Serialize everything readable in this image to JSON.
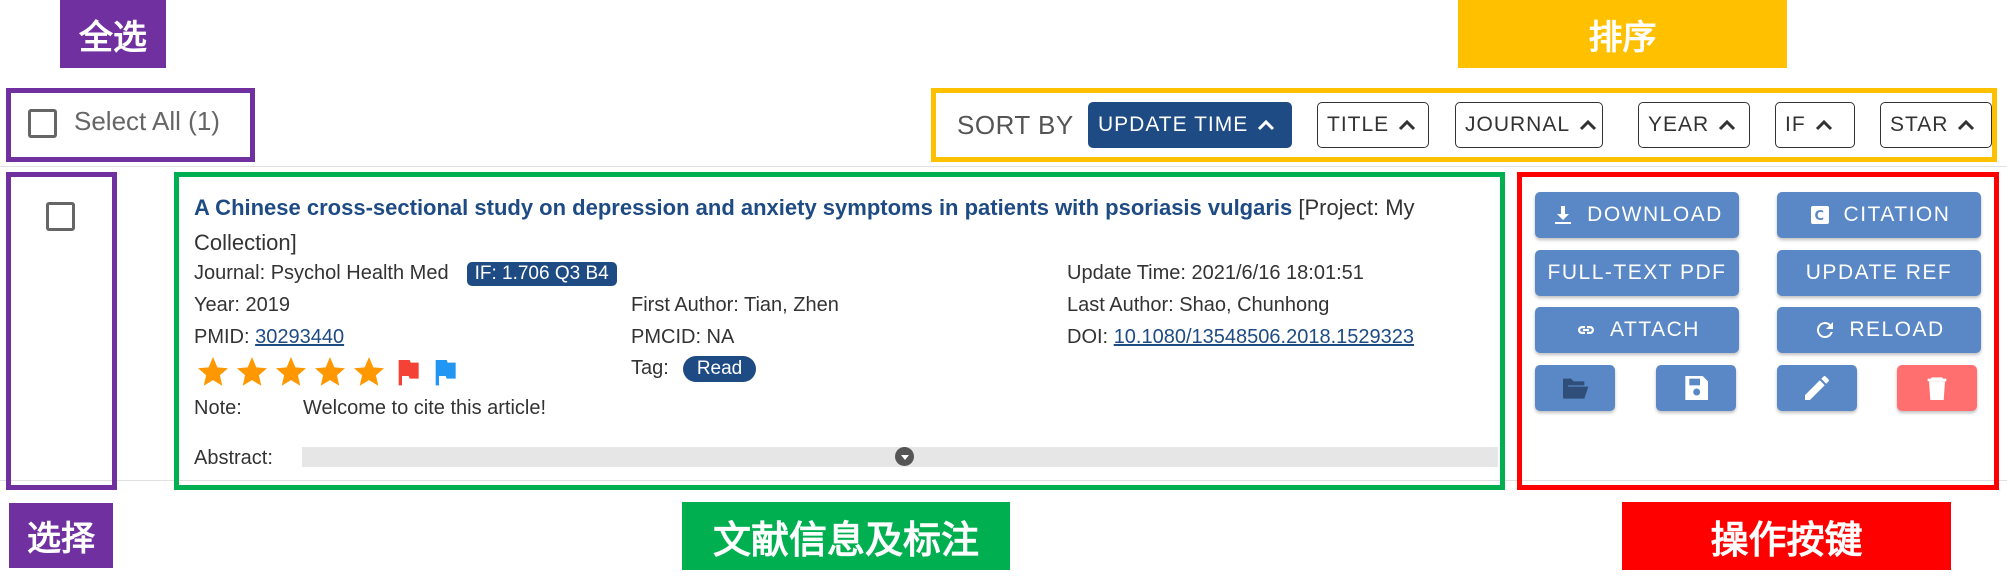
{
  "annotations": {
    "select_all": "全选",
    "sort": "排序",
    "select": "选择",
    "record_info": "文献信息及标注",
    "actions": "操作按键"
  },
  "toolbar": {
    "select_all_label": "Select All (1)",
    "sort_by_label": "SORT BY",
    "sort_options": [
      {
        "label": "UPDATE TIME",
        "active": true,
        "direction": "ascending"
      },
      {
        "label": "TITLE",
        "active": false,
        "direction": "ascending"
      },
      {
        "label": "JOURNAL",
        "active": false,
        "direction": "ascending"
      },
      {
        "label": "YEAR",
        "active": false,
        "direction": "ascending"
      },
      {
        "label": "IF",
        "active": false,
        "direction": "ascending"
      },
      {
        "label": "STAR",
        "active": false,
        "direction": "ascending"
      }
    ]
  },
  "record": {
    "title": "A Chinese cross-sectional study on depression and anxiety symptoms in patients with psoriasis vulgaris",
    "project": "[Project: My Collection]",
    "journal": "Journal: Psychol Health Med",
    "if_badge": "IF: 1.706 Q3 B4",
    "update_time": "Update Time: 2021/6/16 18:01:51",
    "year": "Year: 2019",
    "first_author": "First Author: Tian, Zhen",
    "last_author": "Last Author: Shao, Chunhong",
    "pmid_label": "PMID:",
    "pmid": "30293440",
    "pmcid": "PMCID: NA",
    "doi_label": "DOI:",
    "doi": "10.1080/13548506.2018.1529323",
    "stars": 5,
    "flags": [
      "red-flag",
      "blue-flag"
    ],
    "tag_label": "Tag:",
    "tag": "Read",
    "note_label": "Note:",
    "note": "Welcome to cite this article!",
    "abstract_label": "Abstract:"
  },
  "actions": {
    "download": "DOWNLOAD",
    "citation": "CITATION",
    "full_text_pdf": "FULL-TEXT PDF",
    "update_ref": "UPDATE REF",
    "attach": "ATTACH",
    "reload": "RELOAD",
    "icons": [
      "folder-open-icon",
      "save-icon",
      "edit-icon",
      "delete-icon"
    ]
  },
  "colors": {
    "primary": "#1e4b83",
    "button": "#5a87c5",
    "danger": "#ff6f6f",
    "star": "#ff9800",
    "purple": "#7030a0",
    "yellow": "#ffc000",
    "green": "#00b050",
    "red": "#ff0000"
  }
}
